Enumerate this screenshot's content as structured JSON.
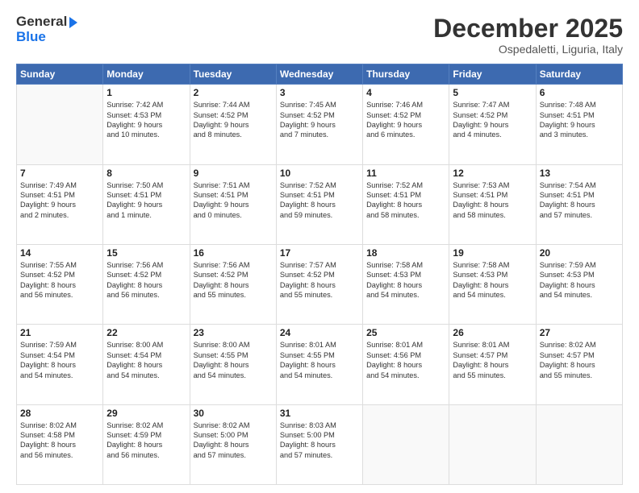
{
  "header": {
    "logo_line1": "General",
    "logo_line2": "Blue",
    "month": "December 2025",
    "location": "Ospedaletti, Liguria, Italy"
  },
  "days_of_week": [
    "Sunday",
    "Monday",
    "Tuesday",
    "Wednesday",
    "Thursday",
    "Friday",
    "Saturday"
  ],
  "weeks": [
    [
      {
        "day": "",
        "info": ""
      },
      {
        "day": "1",
        "info": "Sunrise: 7:42 AM\nSunset: 4:53 PM\nDaylight: 9 hours\nand 10 minutes."
      },
      {
        "day": "2",
        "info": "Sunrise: 7:44 AM\nSunset: 4:52 PM\nDaylight: 9 hours\nand 8 minutes."
      },
      {
        "day": "3",
        "info": "Sunrise: 7:45 AM\nSunset: 4:52 PM\nDaylight: 9 hours\nand 7 minutes."
      },
      {
        "day": "4",
        "info": "Sunrise: 7:46 AM\nSunset: 4:52 PM\nDaylight: 9 hours\nand 6 minutes."
      },
      {
        "day": "5",
        "info": "Sunrise: 7:47 AM\nSunset: 4:52 PM\nDaylight: 9 hours\nand 4 minutes."
      },
      {
        "day": "6",
        "info": "Sunrise: 7:48 AM\nSunset: 4:51 PM\nDaylight: 9 hours\nand 3 minutes."
      }
    ],
    [
      {
        "day": "7",
        "info": "Sunrise: 7:49 AM\nSunset: 4:51 PM\nDaylight: 9 hours\nand 2 minutes."
      },
      {
        "day": "8",
        "info": "Sunrise: 7:50 AM\nSunset: 4:51 PM\nDaylight: 9 hours\nand 1 minute."
      },
      {
        "day": "9",
        "info": "Sunrise: 7:51 AM\nSunset: 4:51 PM\nDaylight: 9 hours\nand 0 minutes."
      },
      {
        "day": "10",
        "info": "Sunrise: 7:52 AM\nSunset: 4:51 PM\nDaylight: 8 hours\nand 59 minutes."
      },
      {
        "day": "11",
        "info": "Sunrise: 7:52 AM\nSunset: 4:51 PM\nDaylight: 8 hours\nand 58 minutes."
      },
      {
        "day": "12",
        "info": "Sunrise: 7:53 AM\nSunset: 4:51 PM\nDaylight: 8 hours\nand 58 minutes."
      },
      {
        "day": "13",
        "info": "Sunrise: 7:54 AM\nSunset: 4:51 PM\nDaylight: 8 hours\nand 57 minutes."
      }
    ],
    [
      {
        "day": "14",
        "info": "Sunrise: 7:55 AM\nSunset: 4:52 PM\nDaylight: 8 hours\nand 56 minutes."
      },
      {
        "day": "15",
        "info": "Sunrise: 7:56 AM\nSunset: 4:52 PM\nDaylight: 8 hours\nand 56 minutes."
      },
      {
        "day": "16",
        "info": "Sunrise: 7:56 AM\nSunset: 4:52 PM\nDaylight: 8 hours\nand 55 minutes."
      },
      {
        "day": "17",
        "info": "Sunrise: 7:57 AM\nSunset: 4:52 PM\nDaylight: 8 hours\nand 55 minutes."
      },
      {
        "day": "18",
        "info": "Sunrise: 7:58 AM\nSunset: 4:53 PM\nDaylight: 8 hours\nand 54 minutes."
      },
      {
        "day": "19",
        "info": "Sunrise: 7:58 AM\nSunset: 4:53 PM\nDaylight: 8 hours\nand 54 minutes."
      },
      {
        "day": "20",
        "info": "Sunrise: 7:59 AM\nSunset: 4:53 PM\nDaylight: 8 hours\nand 54 minutes."
      }
    ],
    [
      {
        "day": "21",
        "info": "Sunrise: 7:59 AM\nSunset: 4:54 PM\nDaylight: 8 hours\nand 54 minutes."
      },
      {
        "day": "22",
        "info": "Sunrise: 8:00 AM\nSunset: 4:54 PM\nDaylight: 8 hours\nand 54 minutes."
      },
      {
        "day": "23",
        "info": "Sunrise: 8:00 AM\nSunset: 4:55 PM\nDaylight: 8 hours\nand 54 minutes."
      },
      {
        "day": "24",
        "info": "Sunrise: 8:01 AM\nSunset: 4:55 PM\nDaylight: 8 hours\nand 54 minutes."
      },
      {
        "day": "25",
        "info": "Sunrise: 8:01 AM\nSunset: 4:56 PM\nDaylight: 8 hours\nand 54 minutes."
      },
      {
        "day": "26",
        "info": "Sunrise: 8:01 AM\nSunset: 4:57 PM\nDaylight: 8 hours\nand 55 minutes."
      },
      {
        "day": "27",
        "info": "Sunrise: 8:02 AM\nSunset: 4:57 PM\nDaylight: 8 hours\nand 55 minutes."
      }
    ],
    [
      {
        "day": "28",
        "info": "Sunrise: 8:02 AM\nSunset: 4:58 PM\nDaylight: 8 hours\nand 56 minutes."
      },
      {
        "day": "29",
        "info": "Sunrise: 8:02 AM\nSunset: 4:59 PM\nDaylight: 8 hours\nand 56 minutes."
      },
      {
        "day": "30",
        "info": "Sunrise: 8:02 AM\nSunset: 5:00 PM\nDaylight: 8 hours\nand 57 minutes."
      },
      {
        "day": "31",
        "info": "Sunrise: 8:03 AM\nSunset: 5:00 PM\nDaylight: 8 hours\nand 57 minutes."
      },
      {
        "day": "",
        "info": ""
      },
      {
        "day": "",
        "info": ""
      },
      {
        "day": "",
        "info": ""
      }
    ]
  ]
}
